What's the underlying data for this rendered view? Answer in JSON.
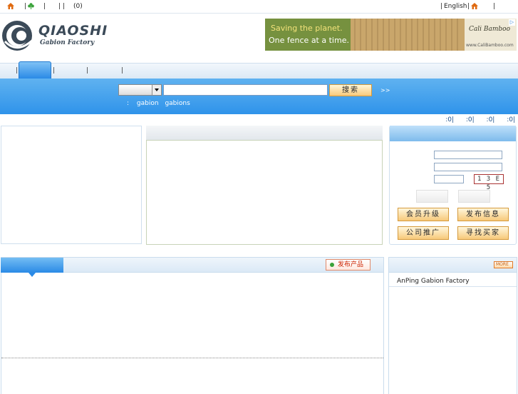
{
  "topbar": {
    "cart_count": "(0)",
    "lang": "English",
    "sep": "|",
    "sep2": "|  |"
  },
  "logo": {
    "name": "QIAOSHI",
    "subtitle": "Gabion Factory"
  },
  "ad": {
    "line1": "Saving the planet.",
    "line2": "One fence at a time.",
    "brand": "Cali Bamboo",
    "url": "www.CaliBamboo.com"
  },
  "nav": {
    "sep": "|"
  },
  "search": {
    "button": "搜索",
    "advanced": ">>",
    "hot_prefix": ":",
    "hot_1": "gabion",
    "hot_2": "gabions"
  },
  "stats": {
    "text": ":0|  :0|  :0|  :0|"
  },
  "login": {
    "captcha": "1 3 E 5",
    "btn_upgrade": "会员升级",
    "btn_publish": "发布信息",
    "btn_promote": "公司推广",
    "btn_find": "寻找买家"
  },
  "products": {
    "publish_btn": "发布产品"
  },
  "right_panel": {
    "more": "MORE",
    "link": "AnPing Gabion Factory"
  },
  "colors": {
    "accent_blue": "#2f93ea",
    "orange_btn": "#f7c97a",
    "link_blue": "#1a4e8a"
  }
}
